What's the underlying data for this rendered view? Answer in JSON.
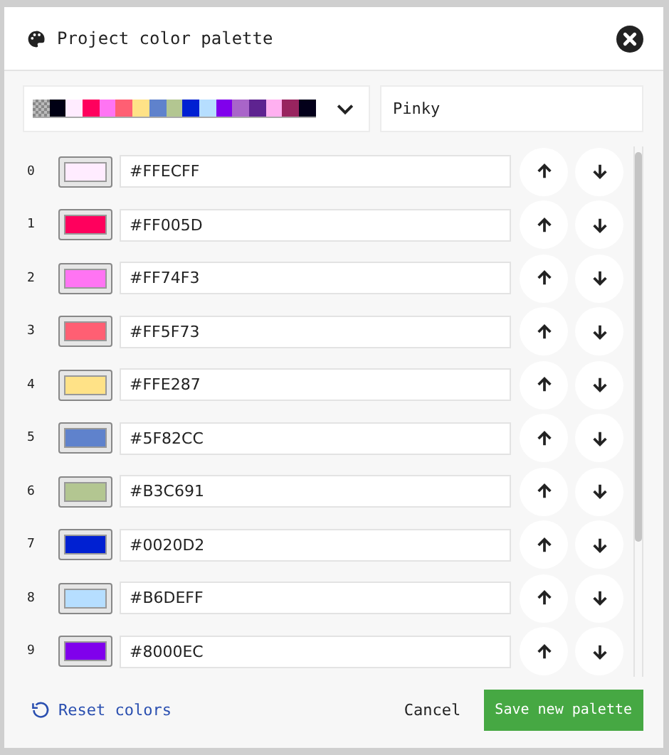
{
  "dialog": {
    "title": "Project color palette"
  },
  "palette_strip": [
    {
      "color": "#000014"
    },
    {
      "color": "#ffecff"
    },
    {
      "color": "#ff005d"
    },
    {
      "color": "#ff74f3"
    },
    {
      "color": "#ff5f73"
    },
    {
      "color": "#ffe287"
    },
    {
      "color": "#5f82cc"
    },
    {
      "color": "#b3c691"
    },
    {
      "color": "#0020d2"
    },
    {
      "color": "#b6deff"
    },
    {
      "color": "#8000ec"
    },
    {
      "color": "#a965c9"
    },
    {
      "color": "#5e2390"
    },
    {
      "color": "#ffb0f0"
    },
    {
      "color": "#98245f"
    },
    {
      "color": "#03001a"
    }
  ],
  "palette_name": "Pinky",
  "colors": [
    {
      "index": "0",
      "value": "#FFECFF",
      "color": "#ffecff"
    },
    {
      "index": "1",
      "value": "#FF005D",
      "color": "#ff005d"
    },
    {
      "index": "2",
      "value": "#FF74F3",
      "color": "#ff74f3"
    },
    {
      "index": "3",
      "value": "#FF5F73",
      "color": "#ff5f73"
    },
    {
      "index": "4",
      "value": "#FFE287",
      "color": "#ffe287"
    },
    {
      "index": "5",
      "value": "#5F82CC",
      "color": "#5f82cc"
    },
    {
      "index": "6",
      "value": "#B3C691",
      "color": "#b3c691"
    },
    {
      "index": "7",
      "value": "#0020D2",
      "color": "#0020d2"
    },
    {
      "index": "8",
      "value": "#B6DEFF",
      "color": "#b6deff"
    },
    {
      "index": "9",
      "value": "#8000EC",
      "color": "#8000ec"
    }
  ],
  "footer": {
    "reset": "Reset colors",
    "cancel": "Cancel",
    "save": "Save new palette"
  }
}
